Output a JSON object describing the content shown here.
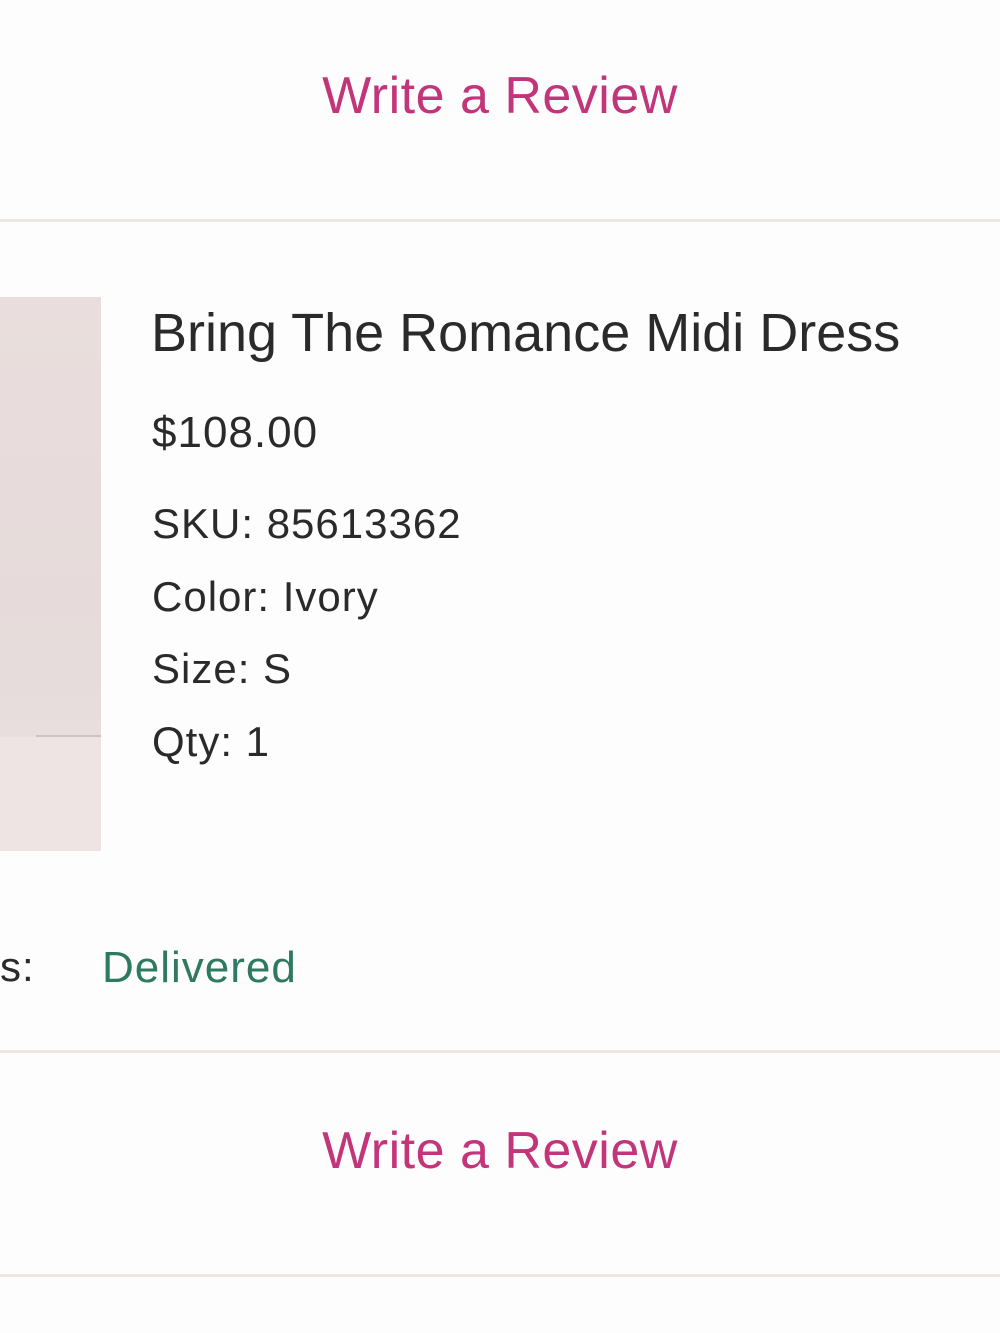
{
  "review_top": {
    "label": "Write a Review"
  },
  "product": {
    "name": "Bring The Romance Midi Dress",
    "price": "$108.00",
    "sku": "SKU: 85613362",
    "color": "Color: Ivory",
    "size": "Size: S",
    "qty": "Qty: 1"
  },
  "status": {
    "label": "s:",
    "value": "Delivered"
  },
  "review_bottom": {
    "label": "Write a Review"
  },
  "colors": {
    "accent": "#c2357a",
    "status_delivered": "#2e7a5f",
    "divider": "#ece8e5"
  }
}
